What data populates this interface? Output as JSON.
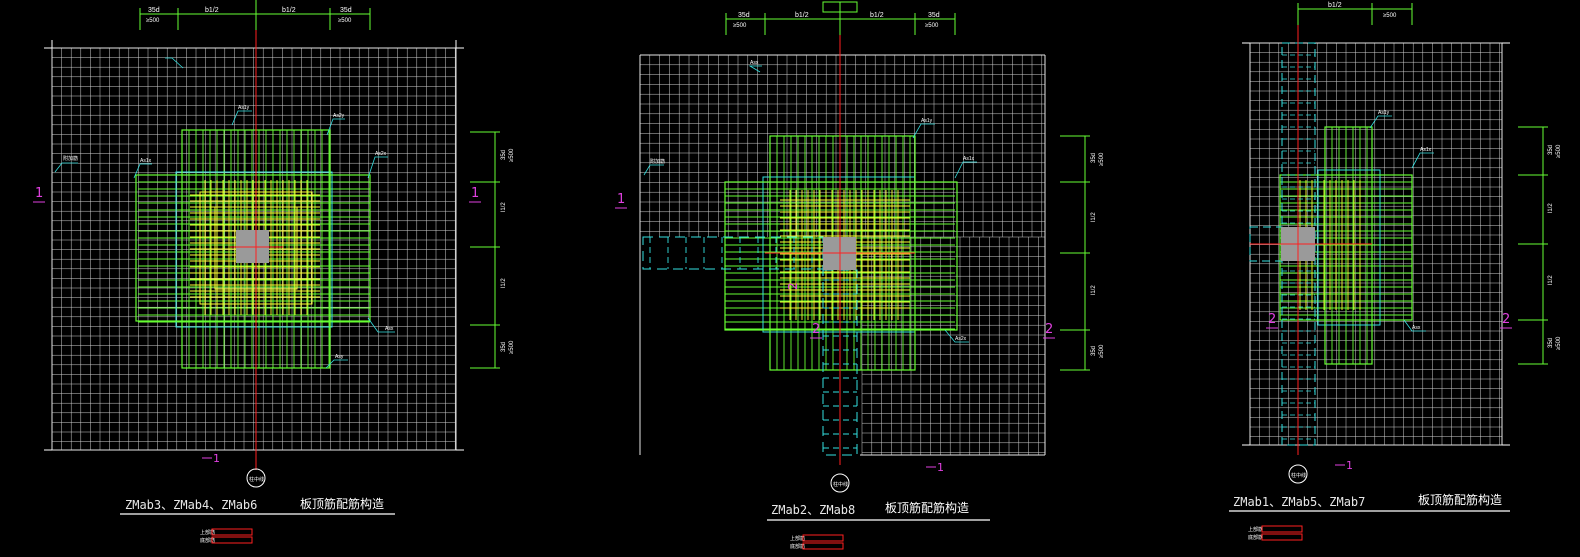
{
  "drawings": [
    {
      "id": "d1",
      "title": "ZMab3、ZMab4、ZMab6",
      "subtitle": "板顶筋配筋构造",
      "axis_label": "柱中线",
      "section_marks": [
        "1",
        "1",
        "1"
      ],
      "top_dims": [
        "35d",
        "b1/2",
        "b1/2",
        "35d"
      ],
      "top_sub_dims": [
        "≥500",
        "≥500"
      ],
      "right_dims": [
        "35d",
        "l1/2",
        "l1/2",
        "35d"
      ],
      "right_sub_dims": [
        "≥500",
        "≥500"
      ],
      "legend_rows": [
        "上部筋",
        "底部筋"
      ],
      "rebar_labels": [
        "附加筋",
        "As1y",
        "As2y",
        "As1x",
        "As2x",
        "Asx",
        "Asy"
      ]
    },
    {
      "id": "d2",
      "title": "ZMab2、ZMab8",
      "subtitle": "板顶筋配筋构造",
      "axis_label": "柱中线",
      "section_marks": [
        "1",
        "2",
        "2",
        "2",
        "1"
      ],
      "top_dims": [
        "35d",
        "b1/2",
        "b1/2",
        "35d"
      ],
      "top_sub_dims": [
        "≥500",
        "≥500"
      ],
      "right_dims": [
        "35d",
        "l1/2",
        "l1/2",
        "35d"
      ],
      "right_sub_dims": [
        "≥500",
        "≥500"
      ],
      "legend_rows": [
        "上部筋",
        "底部筋"
      ],
      "rebar_labels": [
        "附加筋",
        "As1y",
        "As1x",
        "As2x",
        "Asx"
      ]
    },
    {
      "id": "d3",
      "title": "ZMab1、ZMab5、ZMab7",
      "subtitle": "板顶筋配筋构造",
      "axis_label": "柱中线",
      "section_marks": [
        "2",
        "2",
        "1"
      ],
      "top_dims": [
        "b1/2"
      ],
      "top_sub_dims": [
        "≥500"
      ],
      "right_dims": [
        "35d",
        "l1/2",
        "l1/2",
        "35d"
      ],
      "right_sub_dims": [
        "≥500",
        "≥500"
      ],
      "legend_rows": [
        "上部筋",
        "底部筋"
      ],
      "rebar_labels": [
        "As1y",
        "As1x",
        "Asx"
      ]
    }
  ],
  "colors": {
    "background": "#000000",
    "grid": "#e6e6e6",
    "rebar_green": "#66ff33",
    "rebar_yellow": "#ffff33",
    "rebar_cyan": "#33e0e0",
    "column_fill": "#9a9a9a",
    "centerline": "#ff2020",
    "section_mark": "#e040e0",
    "legend_red": "#ff2020"
  }
}
